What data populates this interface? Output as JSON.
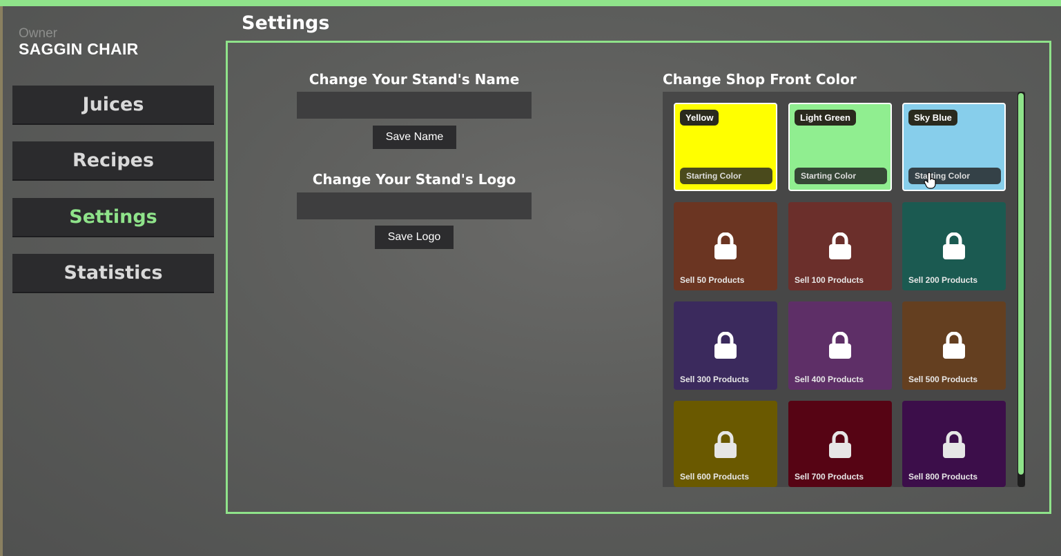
{
  "owner": {
    "label": "Owner",
    "name": "SAGGIN CHAIR"
  },
  "nav": {
    "items": [
      {
        "label": "Juices",
        "active": false
      },
      {
        "label": "Recipes",
        "active": false
      },
      {
        "label": "Settings",
        "active": true
      },
      {
        "label": "Statistics",
        "active": false
      }
    ]
  },
  "page": {
    "title": "Settings"
  },
  "name_section": {
    "heading": "Change Your Stand's Name",
    "value": "",
    "button": "Save Name"
  },
  "logo_section": {
    "heading": "Change Your Stand's Logo",
    "value": "",
    "button": "Save Logo"
  },
  "color_section": {
    "heading": "Change Shop Front Color",
    "tiles": [
      {
        "name": "Yellow",
        "tag": "Starting Color",
        "color": "#ffff00",
        "locked": false
      },
      {
        "name": "Light Green",
        "tag": "Starting Color",
        "color": "#90ee90",
        "locked": false
      },
      {
        "name": "Sky Blue",
        "tag": "Starting Color",
        "color": "#87ceeb",
        "locked": false
      },
      {
        "requirement": "Sell 50 Products",
        "color": "#6b3522",
        "locked": true
      },
      {
        "requirement": "Sell 100 Products",
        "color": "#6b2f2b",
        "locked": true
      },
      {
        "requirement": "Sell 200 Products",
        "color": "#1b5a51",
        "locked": true
      },
      {
        "requirement": "Sell 300 Products",
        "color": "#3b2a5d",
        "locked": true
      },
      {
        "requirement": "Sell 400 Products",
        "color": "#5e2f67",
        "locked": true
      },
      {
        "requirement": "Sell 500 Products",
        "color": "#643f20",
        "locked": true
      },
      {
        "requirement": "Sell 600 Products",
        "color": "#6a5900",
        "locked": true
      },
      {
        "requirement": "Sell 700 Products",
        "color": "#560414",
        "locked": true
      },
      {
        "requirement": "Sell 800 Products",
        "color": "#3c0e4a",
        "locked": true
      }
    ]
  },
  "accent_color": "#8fe38a"
}
